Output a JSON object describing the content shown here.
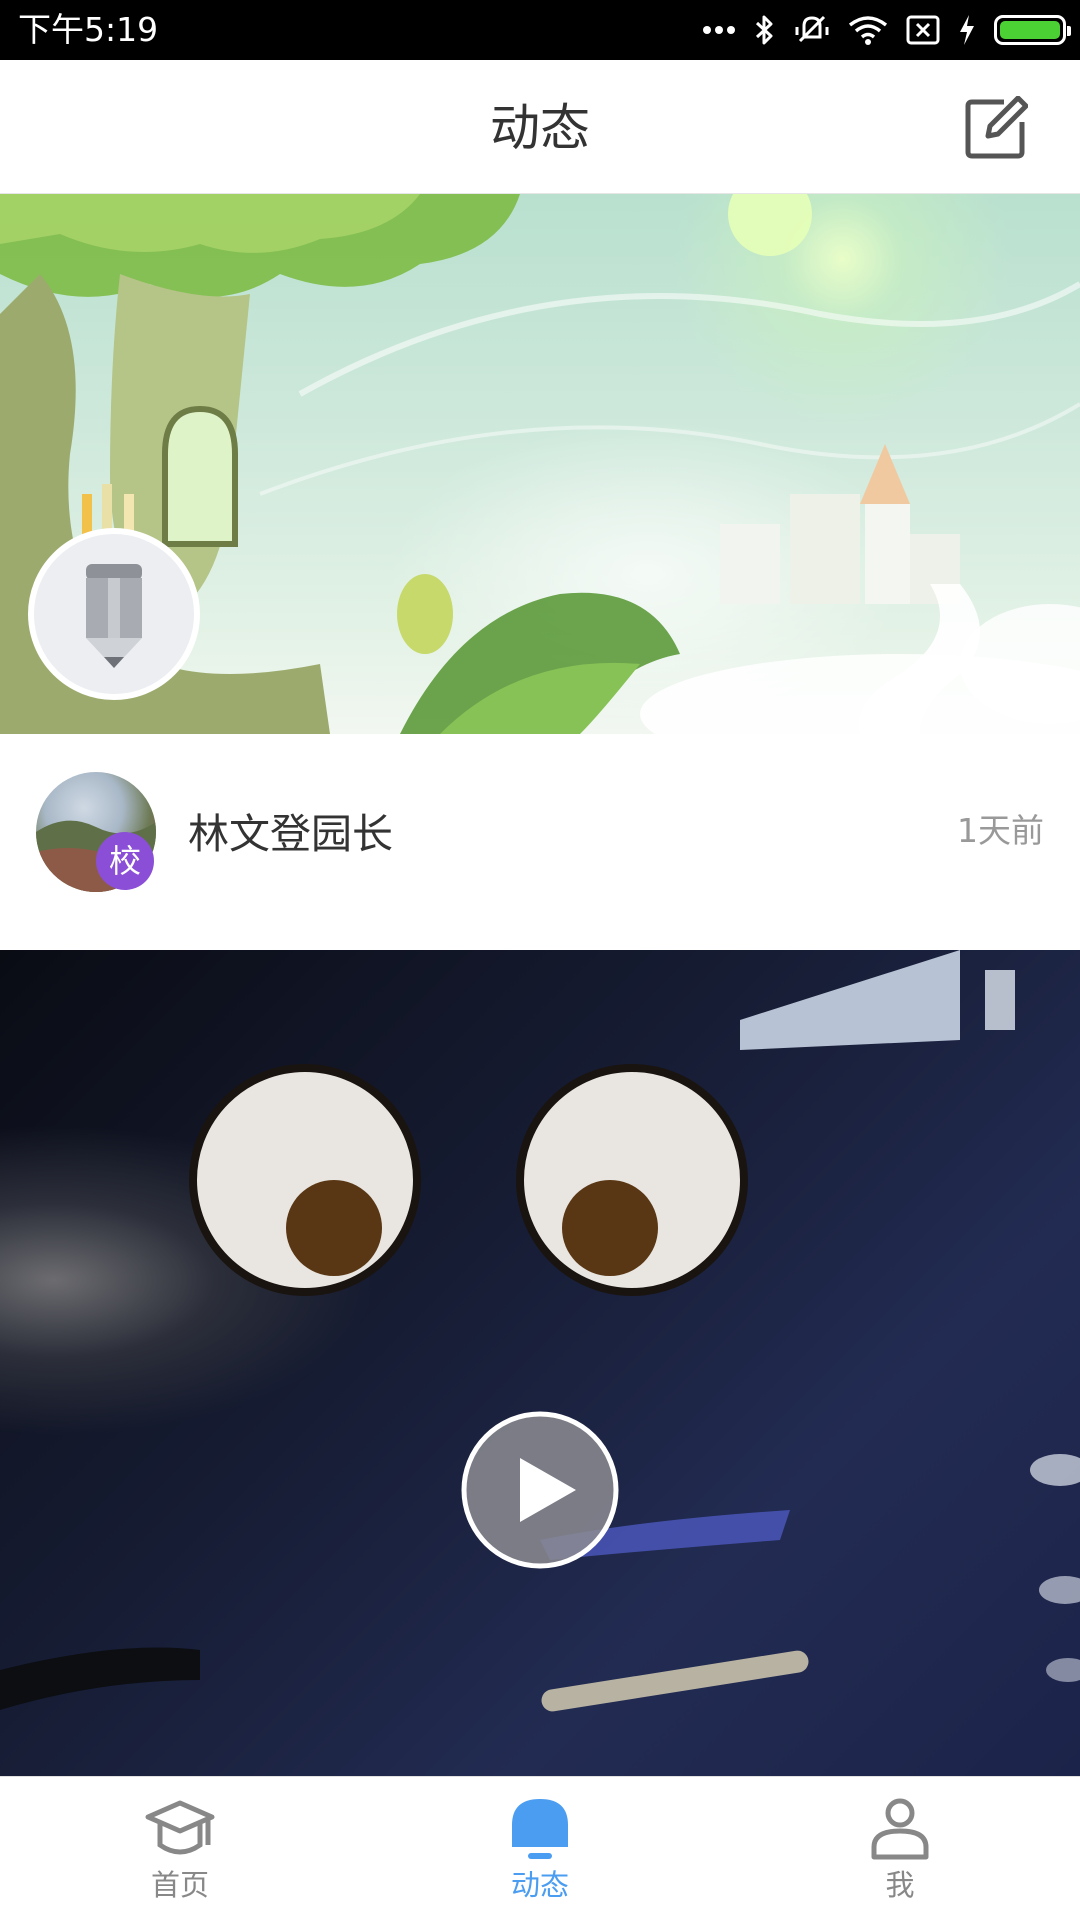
{
  "status_bar": {
    "time": "下午5:19"
  },
  "header": {
    "title": "动态"
  },
  "post": {
    "author": "林文登园长",
    "badge": "校",
    "time": "1天前"
  },
  "nav": {
    "items": [
      {
        "label": "首页",
        "icon": "graduation-cap-icon",
        "active": false
      },
      {
        "label": "动态",
        "icon": "bell-icon",
        "active": true
      },
      {
        "label": "我",
        "icon": "person-icon",
        "active": false
      }
    ]
  },
  "colors": {
    "accent": "#4a9df0",
    "badge": "#8a4fd6",
    "battery": "#4cd135"
  }
}
